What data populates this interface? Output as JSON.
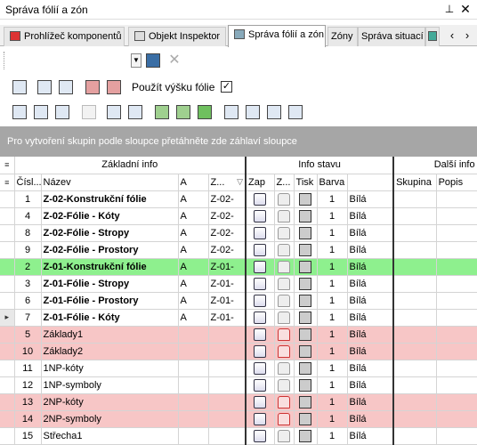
{
  "window": {
    "title": "Správa fólií a zón",
    "pin_icon": "pin-icon",
    "close_icon": "close-icon"
  },
  "tabs": [
    {
      "label": "Prohlížeč komponentů",
      "active": false
    },
    {
      "label": "Objekt Inspektor",
      "active": false
    },
    {
      "label": "Správa fólií a zón",
      "active": true
    },
    {
      "label": "Zóny",
      "active": false
    },
    {
      "label": "Správa situací",
      "active": false
    }
  ],
  "toolbar2": {
    "use_height_label": "Použít výšku fólie",
    "use_height_checked": "✓"
  },
  "group_panel_text": "Pro vytvoření skupin podle sloupce přetáhněte zde záhlaví sloupce",
  "bands": {
    "basic": "Základní info",
    "status": "Info stavu",
    "more": "Další info"
  },
  "columns": {
    "num": "Čísl...",
    "name": "Název",
    "a": "A",
    "z": "Z...",
    "zap": "Zap",
    "z2": "Z...",
    "tisk": "Tisk",
    "barva": "Barva",
    "skupina": "Skupina",
    "popis": "Popis"
  },
  "rows": [
    {
      "num": "1",
      "name": "Z-02-Konstrukční fólie",
      "a": "A",
      "z": "Z-02-",
      "lock": "gray",
      "pen": "1",
      "color": "Bílá",
      "bold": true,
      "style": ""
    },
    {
      "num": "4",
      "name": "Z-02-Fólie - Kóty",
      "a": "A",
      "z": "Z-02-",
      "lock": "gray",
      "pen": "1",
      "color": "Bílá",
      "bold": true,
      "style": ""
    },
    {
      "num": "8",
      "name": "Z-02-Fólie - Stropy",
      "a": "A",
      "z": "Z-02-",
      "lock": "gray",
      "pen": "1",
      "color": "Bílá",
      "bold": true,
      "style": ""
    },
    {
      "num": "9",
      "name": "Z-02-Fólie - Prostory",
      "a": "A",
      "z": "Z-02-",
      "lock": "gray",
      "pen": "1",
      "color": "Bílá",
      "bold": true,
      "style": ""
    },
    {
      "num": "2",
      "name": "Z-01-Konstrukční fólie",
      "a": "A",
      "z": "Z-01-",
      "lock": "gray",
      "pen": "1",
      "color": "Bílá",
      "bold": true,
      "style": "green"
    },
    {
      "num": "3",
      "name": "Z-01-Fólie - Stropy",
      "a": "A",
      "z": "Z-01-",
      "lock": "gray",
      "pen": "1",
      "color": "Bílá",
      "bold": true,
      "style": ""
    },
    {
      "num": "6",
      "name": "Z-01-Fólie - Prostory",
      "a": "A",
      "z": "Z-01-",
      "lock": "gray",
      "pen": "1",
      "color": "Bílá",
      "bold": true,
      "style": ""
    },
    {
      "num": "7",
      "name": "Z-01-Fólie - Kóty",
      "a": "A",
      "z": "Z-01-",
      "lock": "gray",
      "pen": "1",
      "color": "Bílá",
      "bold": true,
      "style": "cur"
    },
    {
      "num": "5",
      "name": "Základy1",
      "a": "",
      "z": "",
      "lock": "red",
      "pen": "1",
      "color": "Bílá",
      "bold": false,
      "style": "pink"
    },
    {
      "num": "10",
      "name": "Základy2",
      "a": "",
      "z": "",
      "lock": "red",
      "pen": "1",
      "color": "Bílá",
      "bold": false,
      "style": "pink"
    },
    {
      "num": "11",
      "name": "1NP-kóty",
      "a": "",
      "z": "",
      "lock": "gray",
      "pen": "1",
      "color": "Bílá",
      "bold": false,
      "style": ""
    },
    {
      "num": "12",
      "name": "1NP-symboly",
      "a": "",
      "z": "",
      "lock": "gray",
      "pen": "1",
      "color": "Bílá",
      "bold": false,
      "style": ""
    },
    {
      "num": "13",
      "name": "2NP-kóty",
      "a": "",
      "z": "",
      "lock": "red",
      "pen": "1",
      "color": "Bílá",
      "bold": false,
      "style": "pink"
    },
    {
      "num": "14",
      "name": "2NP-symboly",
      "a": "",
      "z": "",
      "lock": "red",
      "pen": "1",
      "color": "Bílá",
      "bold": false,
      "style": "pink"
    },
    {
      "num": "15",
      "name": "Střecha1",
      "a": "",
      "z": "",
      "lock": "gray",
      "pen": "1",
      "color": "Bílá",
      "bold": false,
      "style": ""
    }
  ],
  "colors": {
    "green_row": "#8ef08e",
    "pink_row": "#f7c6c6",
    "group_panel": "#a6a6a6"
  }
}
